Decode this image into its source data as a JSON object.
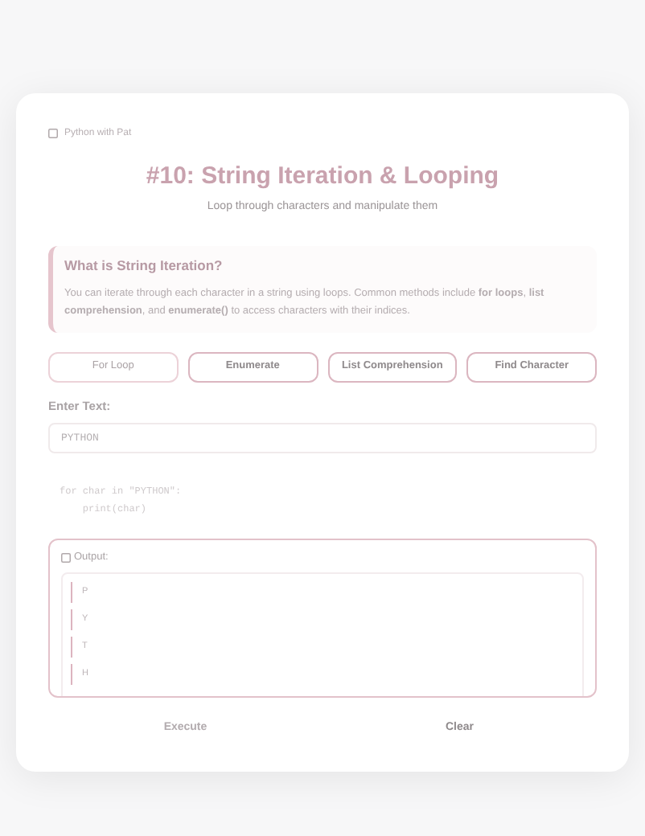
{
  "brand": "Python with Pat",
  "title": "#10: String Iteration & Looping",
  "subtitle": "Loop through characters and manipulate them",
  "info": {
    "heading": "What is String Iteration?",
    "text": "You can iterate through each character in a string using loops. Common methods include **for loops**, **list comprehension**, and **enumerate()** to access characters with their indices."
  },
  "tabs": [
    {
      "label": "For Loop",
      "selected": true
    },
    {
      "label": "Enumerate",
      "selected": false
    },
    {
      "label": "List Comprehension",
      "selected": false
    },
    {
      "label": "Find Character",
      "selected": false
    }
  ],
  "input": {
    "label": "Enter Text:",
    "value": "PYTHON"
  },
  "code": [
    "for char in \"PYTHON\":",
    "    print(char)"
  ],
  "output": {
    "heading": "Output:",
    "lines": [
      "P",
      "Y",
      "T",
      "H"
    ]
  },
  "buttons": [
    {
      "label": "Execute",
      "disabled": true
    },
    {
      "label": "Clear",
      "disabled": false
    }
  ]
}
